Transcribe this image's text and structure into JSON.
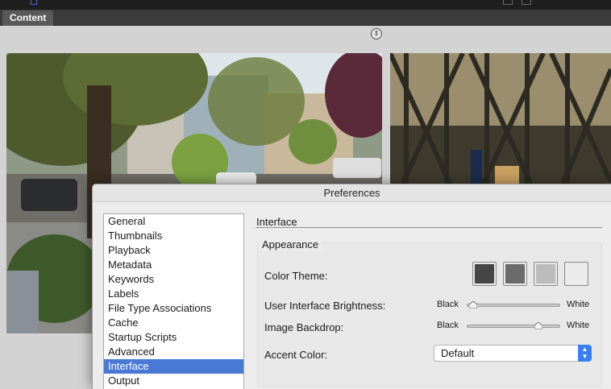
{
  "app": {
    "tab_label": "Content"
  },
  "preferences": {
    "window_title": "Preferences",
    "categories": [
      {
        "label": "General"
      },
      {
        "label": "Thumbnails"
      },
      {
        "label": "Playback"
      },
      {
        "label": "Metadata"
      },
      {
        "label": "Keywords"
      },
      {
        "label": "Labels"
      },
      {
        "label": "File Type Associations"
      },
      {
        "label": "Cache"
      },
      {
        "label": "Startup Scripts"
      },
      {
        "label": "Advanced"
      },
      {
        "label": "Interface",
        "selected": true
      },
      {
        "label": "Output"
      }
    ],
    "section_title": "Interface",
    "appearance": {
      "group_title": "Appearance",
      "color_theme_label": "Color Theme:",
      "color_theme_swatches": [
        "#454545",
        "#6b6b6b",
        "#bcbcbc",
        "#ebebeb"
      ],
      "brightness_label": "User Interface Brightness:",
      "brightness_min_label": "Black",
      "brightness_max_label": "White",
      "brightness_value": 0.02,
      "backdrop_label": "Image Backdrop:",
      "backdrop_min_label": "Black",
      "backdrop_max_label": "White",
      "backdrop_value": 0.8,
      "accent_label": "Accent Color:",
      "accent_value": "Default"
    }
  },
  "colors": {
    "selection": "#4a79d5",
    "accent_stepper": "#3a7ff2"
  },
  "icons": {
    "scroll_toggle": "up-down-arrows-icon",
    "select_stepper": "chevron-up-down-icon"
  }
}
